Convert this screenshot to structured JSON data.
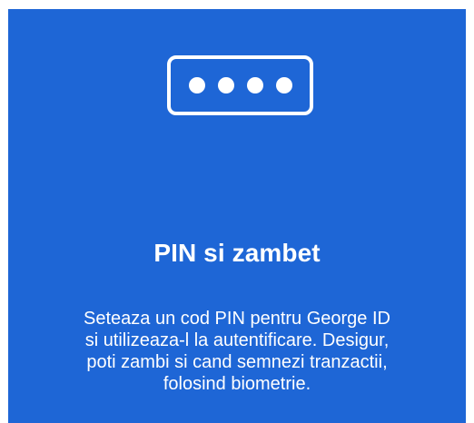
{
  "card": {
    "background_color": "#1e66d6",
    "icon": "pin-code-icon",
    "title": "PIN si zambet",
    "description_lines": [
      "Seteaza un cod PIN pentru George ID",
      "si utilizeaza-l la autentificare. Desigur,",
      "poti zambi si cand semnezi tranzactii,",
      "folosind biometrie."
    ]
  }
}
